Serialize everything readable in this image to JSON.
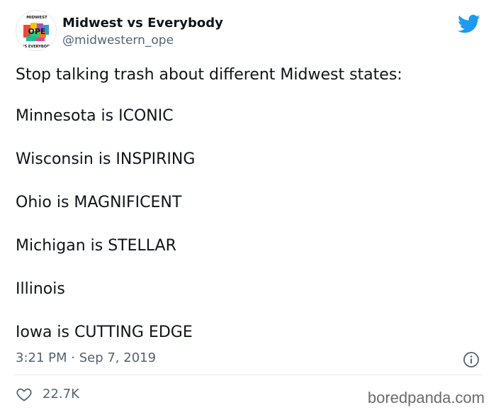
{
  "account": {
    "display_name": "Midwest vs Everybody",
    "handle": "@midwestern_ope",
    "avatar_text_top": "MIDWEST",
    "avatar_text_center": "OPE",
    "avatar_text_bottom": "VS EVERYBODY",
    "verified": false
  },
  "tweet": {
    "lines": [
      "Stop talking trash about different Midwest states:",
      "Minnesota is ICONIC",
      "Wisconsin is INSPIRING",
      "Ohio is MAGNIFICENT",
      "Michigan is STELLAR",
      "Illinois",
      "Iowa is CUTTING EDGE"
    ],
    "time": "3:21 PM · Sep 7, 2019"
  },
  "actions": {
    "like_count": "22.7K"
  },
  "icons": {
    "brand": "twitter-bird-icon",
    "info": "info-icon",
    "like": "heart-icon"
  },
  "colors": {
    "twitter_blue": "#1d9bf0",
    "text_primary": "#0f1419",
    "text_secondary": "#536471"
  },
  "watermark": "boredpanda.com"
}
